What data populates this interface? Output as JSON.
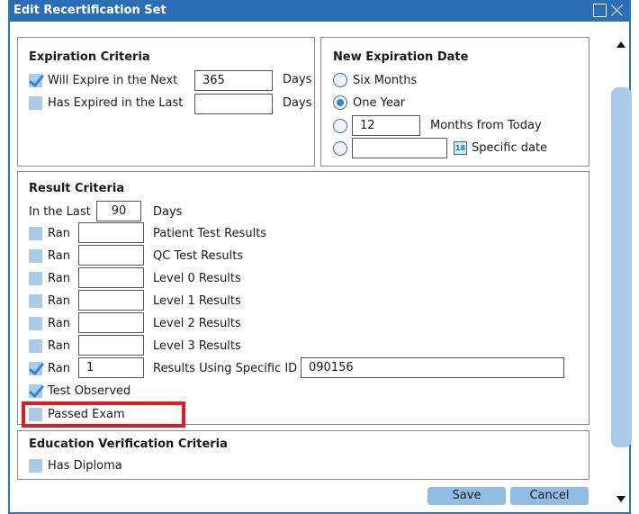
{
  "window": {
    "title": "Edit Recertification Set"
  },
  "expiration": {
    "title": "Expiration Criteria",
    "will_expire_label": "Will Expire in the Next",
    "will_expire_value": "365",
    "will_expire_unit": "Days",
    "has_expired_label": "Has Expired in the Last",
    "has_expired_value": "",
    "has_expired_unit": "Days"
  },
  "new_date": {
    "title": "New Expiration Date",
    "six_months": "Six Months",
    "one_year": "One Year",
    "months_value": "12",
    "months_label": "Months from Today",
    "specific_value": "",
    "calendar_day": "18",
    "specific_label": "Specific date"
  },
  "result": {
    "title": "Result Criteria",
    "in_last_label": "In the Last",
    "in_last_value": "90",
    "in_last_unit": "Days",
    "rows": [
      {
        "ran": "Ran",
        "value": "",
        "label": "Patient Test Results"
      },
      {
        "ran": "Ran",
        "value": "",
        "label": "QC Test Results"
      },
      {
        "ran": "Ran",
        "value": "",
        "label": "Level 0 Results"
      },
      {
        "ran": "Ran",
        "value": "",
        "label": "Level 1 Results"
      },
      {
        "ran": "Ran",
        "value": "",
        "label": "Level 2 Results"
      },
      {
        "ran": "Ran",
        "value": "",
        "label": "Level 3 Results"
      },
      {
        "ran": "Ran",
        "value": "1",
        "label": "Results Using Specific ID"
      }
    ],
    "specific_id_value": "090156",
    "test_observed": "Test Observed",
    "passed_exam": "Passed Exam"
  },
  "education": {
    "title": "Education Verification Criteria",
    "has_diploma": "Has Diploma"
  },
  "footer": {
    "save": "Save",
    "cancel": "Cancel"
  }
}
